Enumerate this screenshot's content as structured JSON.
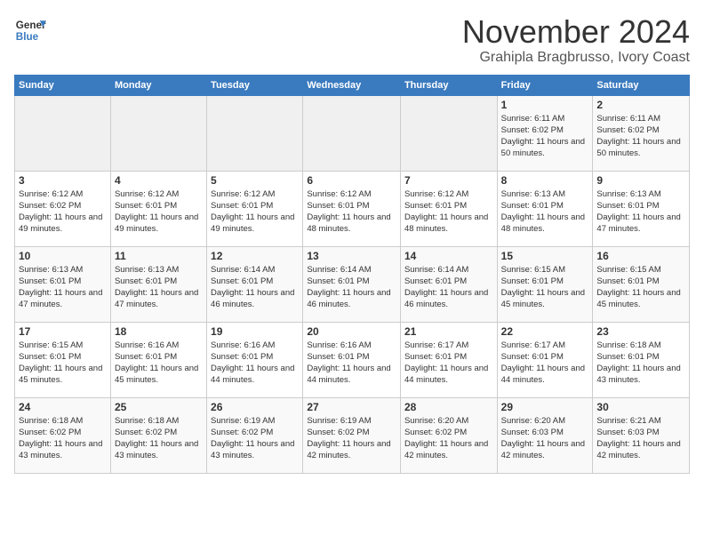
{
  "header": {
    "logo_line1": "General",
    "logo_line2": "Blue",
    "title": "November 2024",
    "subtitle": "Grahipla Bragbrusso, Ivory Coast"
  },
  "days_of_week": [
    "Sunday",
    "Monday",
    "Tuesday",
    "Wednesday",
    "Thursday",
    "Friday",
    "Saturday"
  ],
  "weeks": [
    [
      {
        "day": "",
        "info": ""
      },
      {
        "day": "",
        "info": ""
      },
      {
        "day": "",
        "info": ""
      },
      {
        "day": "",
        "info": ""
      },
      {
        "day": "",
        "info": ""
      },
      {
        "day": "1",
        "info": "Sunrise: 6:11 AM\nSunset: 6:02 PM\nDaylight: 11 hours and 50 minutes."
      },
      {
        "day": "2",
        "info": "Sunrise: 6:11 AM\nSunset: 6:02 PM\nDaylight: 11 hours and 50 minutes."
      }
    ],
    [
      {
        "day": "3",
        "info": "Sunrise: 6:12 AM\nSunset: 6:02 PM\nDaylight: 11 hours and 49 minutes."
      },
      {
        "day": "4",
        "info": "Sunrise: 6:12 AM\nSunset: 6:01 PM\nDaylight: 11 hours and 49 minutes."
      },
      {
        "day": "5",
        "info": "Sunrise: 6:12 AM\nSunset: 6:01 PM\nDaylight: 11 hours and 49 minutes."
      },
      {
        "day": "6",
        "info": "Sunrise: 6:12 AM\nSunset: 6:01 PM\nDaylight: 11 hours and 48 minutes."
      },
      {
        "day": "7",
        "info": "Sunrise: 6:12 AM\nSunset: 6:01 PM\nDaylight: 11 hours and 48 minutes."
      },
      {
        "day": "8",
        "info": "Sunrise: 6:13 AM\nSunset: 6:01 PM\nDaylight: 11 hours and 48 minutes."
      },
      {
        "day": "9",
        "info": "Sunrise: 6:13 AM\nSunset: 6:01 PM\nDaylight: 11 hours and 47 minutes."
      }
    ],
    [
      {
        "day": "10",
        "info": "Sunrise: 6:13 AM\nSunset: 6:01 PM\nDaylight: 11 hours and 47 minutes."
      },
      {
        "day": "11",
        "info": "Sunrise: 6:13 AM\nSunset: 6:01 PM\nDaylight: 11 hours and 47 minutes."
      },
      {
        "day": "12",
        "info": "Sunrise: 6:14 AM\nSunset: 6:01 PM\nDaylight: 11 hours and 46 minutes."
      },
      {
        "day": "13",
        "info": "Sunrise: 6:14 AM\nSunset: 6:01 PM\nDaylight: 11 hours and 46 minutes."
      },
      {
        "day": "14",
        "info": "Sunrise: 6:14 AM\nSunset: 6:01 PM\nDaylight: 11 hours and 46 minutes."
      },
      {
        "day": "15",
        "info": "Sunrise: 6:15 AM\nSunset: 6:01 PM\nDaylight: 11 hours and 45 minutes."
      },
      {
        "day": "16",
        "info": "Sunrise: 6:15 AM\nSunset: 6:01 PM\nDaylight: 11 hours and 45 minutes."
      }
    ],
    [
      {
        "day": "17",
        "info": "Sunrise: 6:15 AM\nSunset: 6:01 PM\nDaylight: 11 hours and 45 minutes."
      },
      {
        "day": "18",
        "info": "Sunrise: 6:16 AM\nSunset: 6:01 PM\nDaylight: 11 hours and 45 minutes."
      },
      {
        "day": "19",
        "info": "Sunrise: 6:16 AM\nSunset: 6:01 PM\nDaylight: 11 hours and 44 minutes."
      },
      {
        "day": "20",
        "info": "Sunrise: 6:16 AM\nSunset: 6:01 PM\nDaylight: 11 hours and 44 minutes."
      },
      {
        "day": "21",
        "info": "Sunrise: 6:17 AM\nSunset: 6:01 PM\nDaylight: 11 hours and 44 minutes."
      },
      {
        "day": "22",
        "info": "Sunrise: 6:17 AM\nSunset: 6:01 PM\nDaylight: 11 hours and 44 minutes."
      },
      {
        "day": "23",
        "info": "Sunrise: 6:18 AM\nSunset: 6:01 PM\nDaylight: 11 hours and 43 minutes."
      }
    ],
    [
      {
        "day": "24",
        "info": "Sunrise: 6:18 AM\nSunset: 6:02 PM\nDaylight: 11 hours and 43 minutes."
      },
      {
        "day": "25",
        "info": "Sunrise: 6:18 AM\nSunset: 6:02 PM\nDaylight: 11 hours and 43 minutes."
      },
      {
        "day": "26",
        "info": "Sunrise: 6:19 AM\nSunset: 6:02 PM\nDaylight: 11 hours and 43 minutes."
      },
      {
        "day": "27",
        "info": "Sunrise: 6:19 AM\nSunset: 6:02 PM\nDaylight: 11 hours and 42 minutes."
      },
      {
        "day": "28",
        "info": "Sunrise: 6:20 AM\nSunset: 6:02 PM\nDaylight: 11 hours and 42 minutes."
      },
      {
        "day": "29",
        "info": "Sunrise: 6:20 AM\nSunset: 6:03 PM\nDaylight: 11 hours and 42 minutes."
      },
      {
        "day": "30",
        "info": "Sunrise: 6:21 AM\nSunset: 6:03 PM\nDaylight: 11 hours and 42 minutes."
      }
    ]
  ],
  "accent_color": "#3a7abf"
}
